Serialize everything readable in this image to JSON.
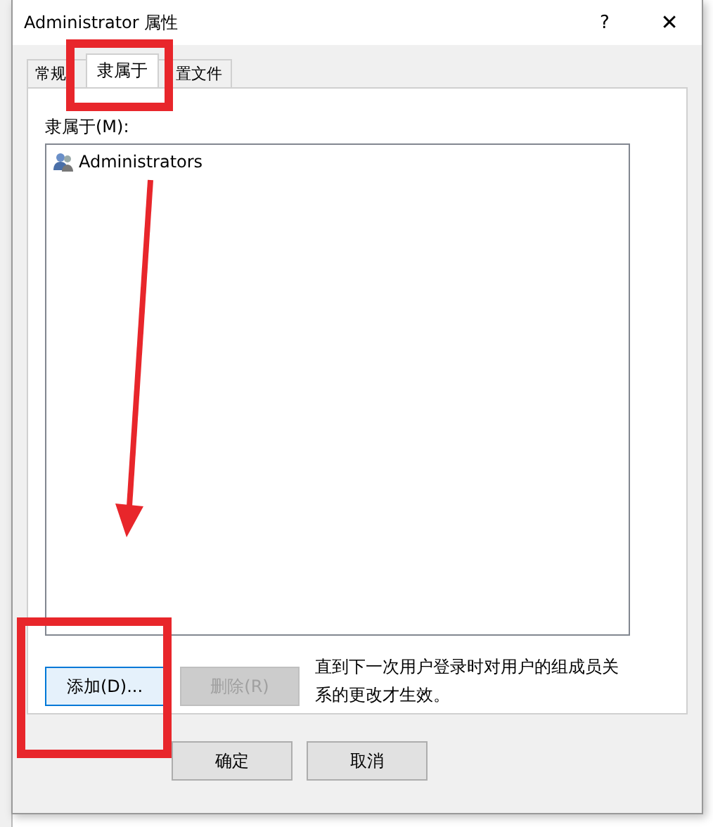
{
  "window": {
    "title": "Administrator 属性",
    "help": "?",
    "close": "✕"
  },
  "tabs": [
    {
      "label": "常规",
      "selected": false
    },
    {
      "label": "隶属于",
      "selected": true
    },
    {
      "label": "置文件",
      "selected": false
    }
  ],
  "member_label": "隶属于(M):",
  "members": [
    {
      "name": "Administrators",
      "selected": false
    }
  ],
  "actions": [
    {
      "label": "添加(D)...",
      "disabled": false
    },
    {
      "label": "删除(R)",
      "disabled": true
    }
  ],
  "note": "直到下一次用户登录时对用户的组成员关系的更改才生效。",
  "buttons": [
    {
      "label": "确定"
    },
    {
      "label": "取消"
    }
  ]
}
